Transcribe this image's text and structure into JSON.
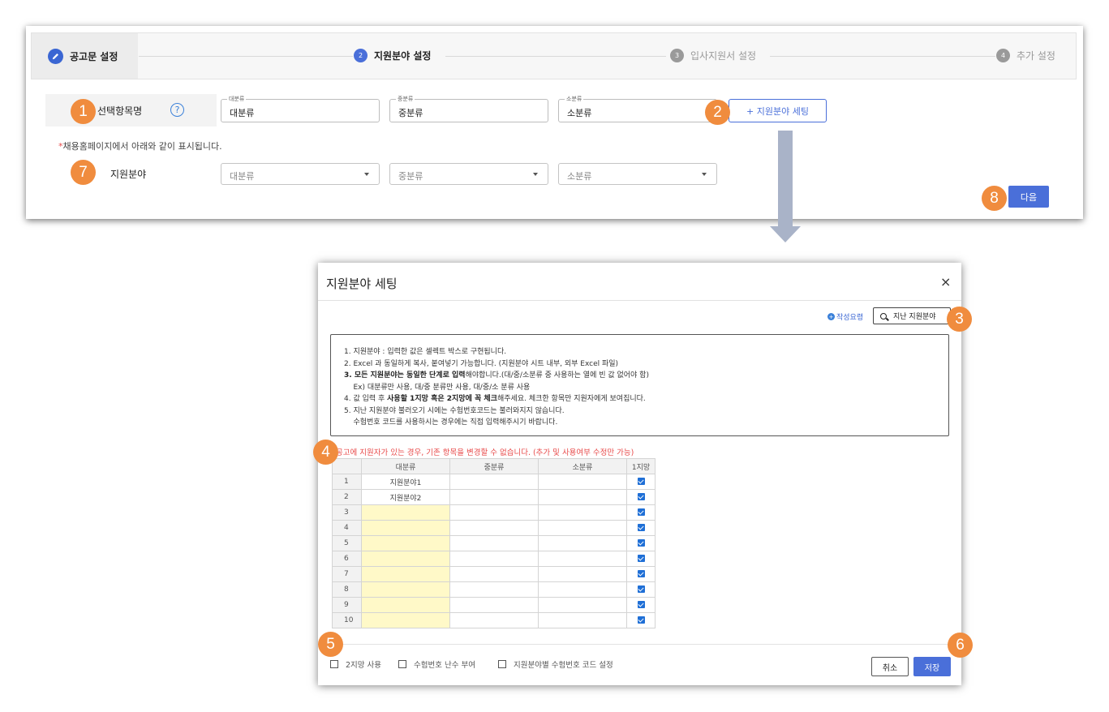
{
  "stepper": {
    "steps": [
      {
        "num": "",
        "label": "공고문 설정",
        "state": "done"
      },
      {
        "num": "2",
        "label": "지원분야 설정",
        "state": "active"
      },
      {
        "num": "3",
        "label": "입사지원서 설정",
        "state": "inactive"
      },
      {
        "num": "4",
        "label": "추가 설정",
        "state": "inactive"
      }
    ]
  },
  "badges": {
    "b1": "1",
    "b2": "2",
    "b3": "3",
    "b4": "4",
    "b5": "5",
    "b6": "6",
    "b7": "7",
    "b8": "8"
  },
  "form": {
    "item_label": "선택항목명",
    "help_glyph": "?",
    "fields": [
      {
        "legend": "대분류",
        "value": "대분류"
      },
      {
        "legend": "중분류",
        "value": "중분류"
      },
      {
        "legend": "소분류",
        "value": "소분류"
      }
    ],
    "setting_button": "+ 지원분야 세팅",
    "notice_star": "*",
    "notice": "채용홈페이지에서 아래와 같이 표시됩니다.",
    "preview_label": "지원분야",
    "preview_selects": [
      "대분류",
      "중분류",
      "소분류"
    ],
    "next_button": "다음"
  },
  "modal": {
    "title": "지원분야 세팅",
    "close": "×",
    "guide_link": "작성요령",
    "guide_icon": "+",
    "prev_button": "지난 지원분야",
    "instructions": [
      {
        "plain": "1. 지원분야 : 입력한 값은 셀렉트 박스로 구현됩니다."
      },
      {
        "plain": "2. Excel 과 동일하게 복사, 붙여넣기 가능합니다. (지원분야 시트 내부, 외부 Excel 파일)"
      },
      {
        "bold": "3. 모든 지원분야는 동일한 단계로 입력",
        "plain": "해야합니다.(대/중/소분류 중 사용하는 열에 빈 값 없어야 함)"
      },
      {
        "plain": "    Ex) 대분류만 사용, 대/중 분류만 사용, 대/중/소 분류 사용"
      },
      {
        "pre": "4. 값 입력 후 ",
        "bold": "사용할 1지망 혹은 2지망에 꼭 체크",
        "plain": "해주세요. 체크한 항목만 지원자에게 보여집니다."
      },
      {
        "plain": "5. 지난 지원분야 불러오기 시에는 수험번호코드는 불러와지지 않습니다."
      },
      {
        "plain": "    수험번호 코드를 사용하시는 경우에는 직접 입력해주시기 바랍니다."
      }
    ],
    "warning": "공고에 지원자가 있는 경우, 기존 항목을 변경할 수 없습니다. (추가 및 사용여부 수정만 가능)",
    "grid": {
      "headers": [
        "",
        "대분류",
        "중분류",
        "소분류",
        "1지망"
      ],
      "rows": [
        {
          "n": "1",
          "major": "지원분야1",
          "mid": "",
          "minor": "",
          "checked": true
        },
        {
          "n": "2",
          "major": "지원분야2",
          "mid": "",
          "minor": "",
          "checked": true
        },
        {
          "n": "3",
          "major": "",
          "mid": "",
          "minor": "",
          "checked": true
        },
        {
          "n": "4",
          "major": "",
          "mid": "",
          "minor": "",
          "checked": true
        },
        {
          "n": "5",
          "major": "",
          "mid": "",
          "minor": "",
          "checked": true
        },
        {
          "n": "6",
          "major": "",
          "mid": "",
          "minor": "",
          "checked": true
        },
        {
          "n": "7",
          "major": "",
          "mid": "",
          "minor": "",
          "checked": true
        },
        {
          "n": "8",
          "major": "",
          "mid": "",
          "minor": "",
          "checked": true
        },
        {
          "n": "9",
          "major": "",
          "mid": "",
          "minor": "",
          "checked": true
        },
        {
          "n": "10",
          "major": "",
          "mid": "",
          "minor": "",
          "checked": true
        }
      ]
    },
    "options": [
      "2지망 사용",
      "수험번호 난수 부여",
      "지원분야별 수험번호 코드 설정"
    ],
    "cancel_button": "취소",
    "save_button": "저장"
  },
  "colors": {
    "accent": "#4a6fd9",
    "badge": "#f08c3e",
    "warning": "#e84a4a",
    "empty_cell": "#fff9c8"
  }
}
